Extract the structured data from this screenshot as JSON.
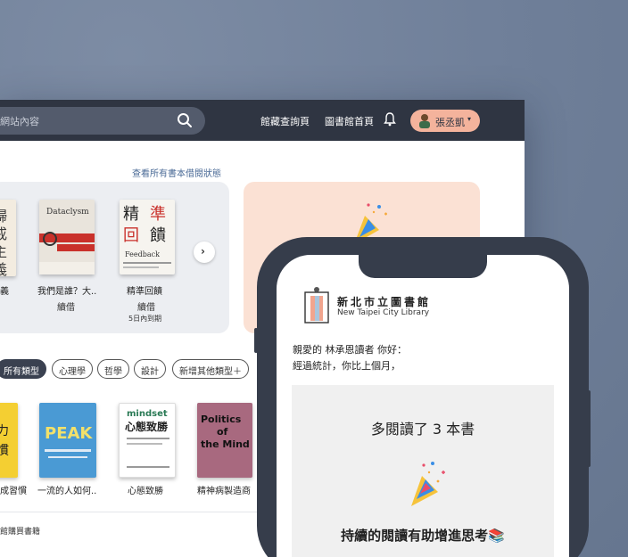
{
  "header": {
    "search_placeholder": "網站內容",
    "nav": [
      "館藏查詢頁",
      "圖書館首頁"
    ],
    "user_name": "張丞凱",
    "user_caret": "▾"
  },
  "borrowed": {
    "view_all_label": "查看所有書本借閱狀態",
    "books": [
      {
        "title": "義",
        "status": ""
      },
      {
        "title": "我們是誰？大..",
        "status": "續借",
        "cover_text": "Dataclysm"
      },
      {
        "title": "精準回饋",
        "status": "續借",
        "due": "5日內到期",
        "cover_text": "精準回饋 Feedback"
      }
    ],
    "next_arrow": "›"
  },
  "categories": {
    "chips": [
      "所有類型",
      "心理學",
      "哲學",
      "設計",
      "新增其他類型＋"
    ],
    "active": "所有類型"
  },
  "recommended": [
    {
      "title": "成習慣"
    },
    {
      "title": "一流的人如何..",
      "cover_text": "PEAK"
    },
    {
      "title": "心態致勝",
      "cover_text": "mindset 心態致勝"
    },
    {
      "title": "精神病製造商",
      "cover_text": "Politics of the Mind"
    }
  ],
  "footer": {
    "text": "館購買書籍"
  },
  "phone": {
    "library_name_zh": "新北市立圖書館",
    "library_name_en": "New Taipei City Library",
    "greeting_line1": "親愛的 林承恩讀者 你好：",
    "greeting_line2": "經過統計，你比上個月，",
    "stat_main": "多閱讀了 3 本書",
    "stat_sub": "持續的閱讀有助增進思考📚"
  },
  "colors": {
    "topbar": "#2f3542",
    "user_pill": "#f4b39c",
    "promo": "#fbe1d4",
    "phone_frame": "#363d4b",
    "link": "#4a6a96"
  }
}
